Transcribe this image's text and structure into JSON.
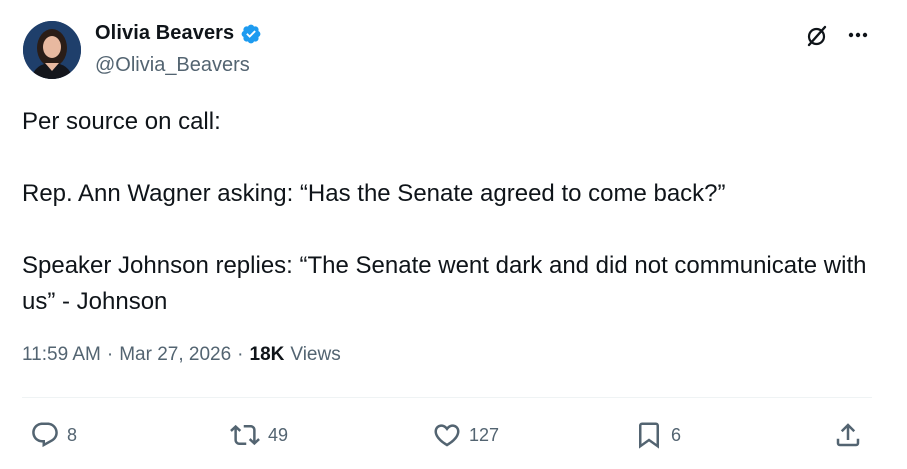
{
  "author": {
    "display_name": "Olivia Beavers",
    "handle": "@Olivia_Beavers",
    "verified": true,
    "avatar_icon": "profile-photo"
  },
  "tweet": {
    "lines": [
      "Per source on call:",
      "",
      "Rep. Ann Wagner asking: “Has the Senate agreed to come back?”",
      "",
      "Speaker Johnson replies: “The Senate went dark and did not communicate with us” - Johnson"
    ]
  },
  "meta": {
    "time": "11:59 AM",
    "separator": "·",
    "date": "Mar 27, 2026",
    "views_count": "18K",
    "views_label": "Views"
  },
  "actions": {
    "replies": "8",
    "reposts": "49",
    "likes": "127",
    "bookmarks": "6"
  },
  "colors": {
    "text": "#0f1419",
    "secondary": "#536471",
    "verified_badge": "#1d9bf0",
    "divider": "#eff3f4"
  }
}
